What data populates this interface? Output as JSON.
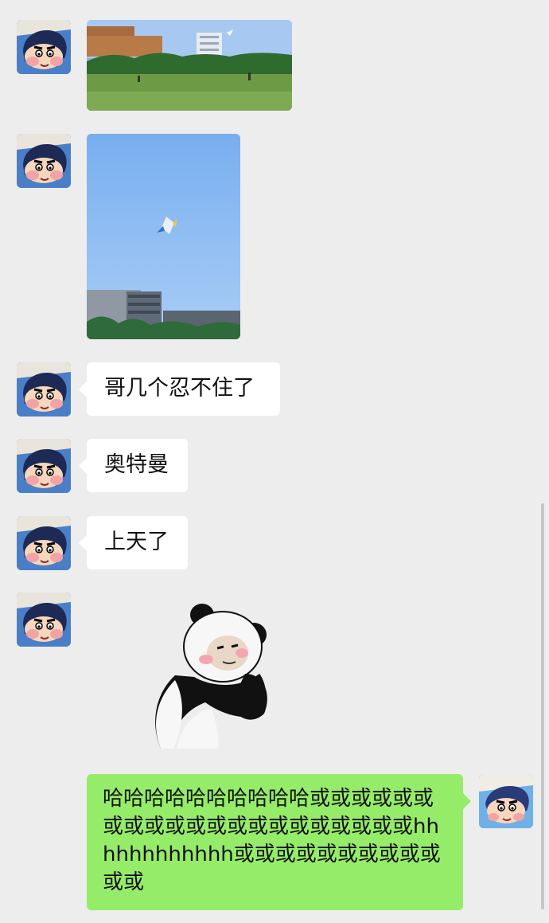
{
  "theme": {
    "background": "#ededed",
    "incoming_bubble": "#ffffff",
    "outgoing_bubble": "#95ec69",
    "text": "#111111"
  },
  "messages": [
    {
      "sender": "friend",
      "type": "image",
      "content": "campus-lawn-kite-photo"
    },
    {
      "sender": "friend",
      "type": "image",
      "content": "kite-in-blue-sky-photo"
    },
    {
      "sender": "friend",
      "type": "text",
      "text": "哥几个忍不住了"
    },
    {
      "sender": "friend",
      "type": "text",
      "text": "奥特曼"
    },
    {
      "sender": "friend",
      "type": "text",
      "text": "上天了"
    },
    {
      "sender": "friend",
      "type": "sticker",
      "content": "panda-man-sticker"
    },
    {
      "sender": "me",
      "type": "text",
      "text": "哈哈哈哈哈哈哈哈哈哈或或或或或或或或或或或或或或或或或或或或或hhhhhhhhhhhh或或或或或或或或或或或或"
    }
  ],
  "avatars": {
    "friend": "cartoon-boy-avatar",
    "me": "cartoon-boy-avatar"
  }
}
